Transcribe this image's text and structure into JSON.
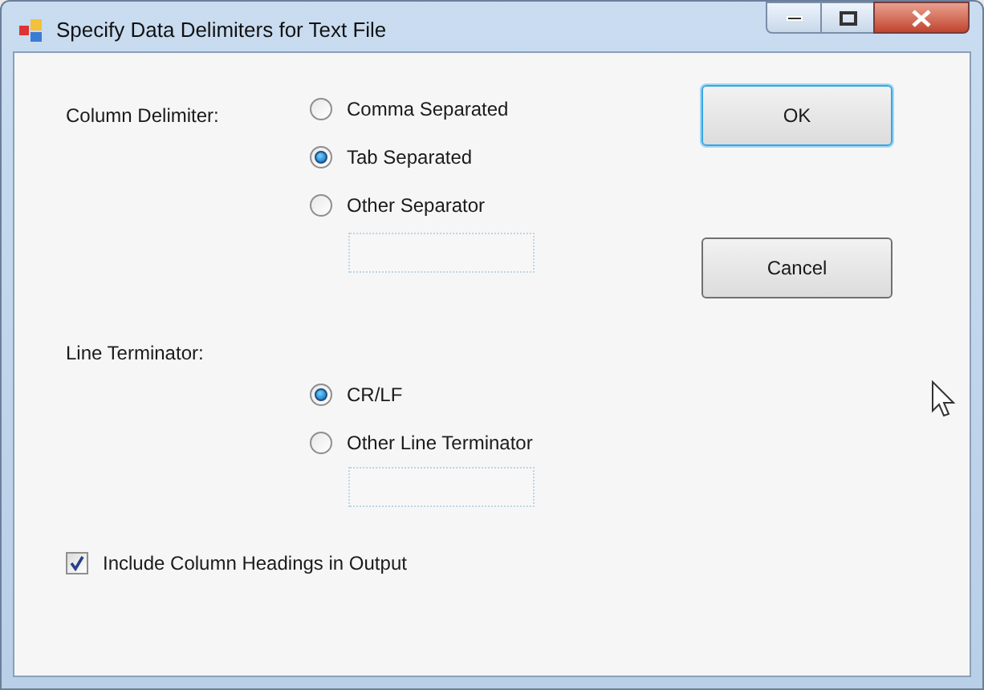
{
  "window": {
    "title": "Specify Data Delimiters for Text File"
  },
  "column_delimiter": {
    "label": "Column Delimiter:",
    "options": [
      {
        "label": "Comma Separated",
        "selected": false
      },
      {
        "label": "Tab Separated",
        "selected": true
      },
      {
        "label": "Other Separator",
        "selected": false
      }
    ]
  },
  "line_terminator": {
    "label": "Line Terminator:",
    "options": [
      {
        "label": "CR/LF",
        "selected": true
      },
      {
        "label": "Other Line Terminator",
        "selected": false
      }
    ]
  },
  "include_headings": {
    "label": "Include Column Headings in Output",
    "checked": true
  },
  "buttons": [
    {
      "label": "OK",
      "default": true
    },
    {
      "label": "Cancel",
      "default": false
    }
  ]
}
